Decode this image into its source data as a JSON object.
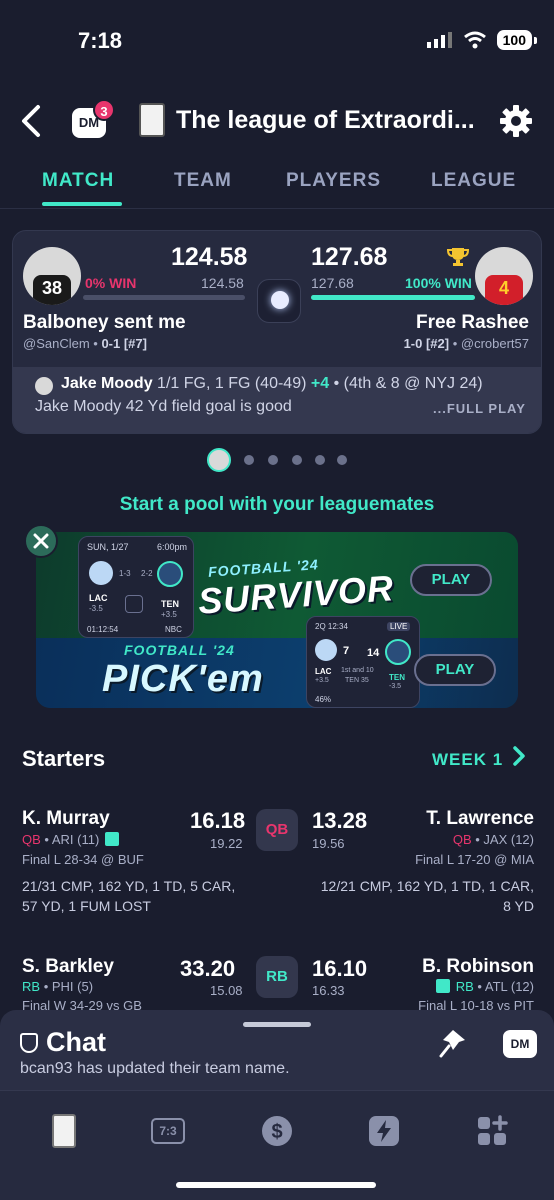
{
  "status_bar": {
    "time": "7:18",
    "battery": "100"
  },
  "header": {
    "dm_label": "DM",
    "dm_badge": "3",
    "league_title": "The league of Extraordi..."
  },
  "tabs": [
    {
      "label": "MATCH",
      "active": true
    },
    {
      "label": "TEAM"
    },
    {
      "label": "PLAYERS"
    },
    {
      "label": "LEAGUE"
    }
  ],
  "match": {
    "left": {
      "jersey": "38",
      "pct_label": "0% WIN",
      "pct_value": 0,
      "score": "124.58",
      "projected": "124.58",
      "team": "Balboney sent me",
      "handle": "@SanClem",
      "record": "0-1 [#7]"
    },
    "right": {
      "jersey": "4",
      "pct_label": "100% WIN",
      "pct_value": 100,
      "score": "127.68",
      "projected": "127.68",
      "team": "Free Rashee",
      "record": "1-0 [#2]",
      "handle": "@crobert57"
    },
    "play": {
      "player": "Jake Moody",
      "line": "1/1 FG, 1 FG (40-49)",
      "points": "+4",
      "context": "• (4th & 8 @ NYJ 24)",
      "description": "Jake Moody 42 Yd field goal is good",
      "full_play": "...FULL PLAY"
    }
  },
  "promo": {
    "title": "Start a pool with your leaguemates",
    "survivor_small": "FOOTBALL '24",
    "survivor_big": "SURVIVOR",
    "survivor_play": "PLAY",
    "pickem_small": "FOOTBALL '24",
    "pickem_big": "PICK'em",
    "pickem_play": "PLAY",
    "card1": {
      "date": "SUN, 1/27",
      "time": "6:00pm",
      "away": "LAC",
      "away_line": "-3.5",
      "home": "TEN",
      "home_line": "+3.5",
      "rec1": "1-3",
      "rec2": "2-2",
      "clock": "01:12:54",
      "network": "NBC"
    },
    "card2": {
      "quarter": "2Q 12:34",
      "live": "LIVE",
      "away": "LAC",
      "away_score": "7",
      "home": "TEN",
      "home_score": "14",
      "down": "1st and 10",
      "spot": "TEN 35",
      "pct": "46%",
      "away_line": "+3.5",
      "home_line": "-3.5"
    }
  },
  "starters": {
    "title": "Starters",
    "week": "WEEK 1",
    "rows": [
      {
        "left": {
          "name": "K. Murray",
          "pos": "QB",
          "team": "• ARI (11)",
          "status": "Final L 28-34 @ BUF",
          "stats1": "21/31 CMP, 162 YD, 1 TD, 5 CAR,",
          "stats2": "57 YD, 1 FUM LOST",
          "score": "16.18",
          "proj": "19.22"
        },
        "slot": "QB",
        "right": {
          "name": "T. Lawrence",
          "pos": "QB",
          "team": "• JAX (12)",
          "status": "Final L 17-20 @ MIA",
          "stats1": "12/21 CMP, 162 YD, 1 TD, 1 CAR,",
          "stats2": "8 YD",
          "score": "13.28",
          "proj": "19.56"
        }
      },
      {
        "left": {
          "name": "S. Barkley",
          "pos": "RB",
          "team": "• PHI (5)",
          "status": "Final W 34-29 vs GB",
          "score": "33.20",
          "proj": "15.08"
        },
        "slot": "RB",
        "right": {
          "name": "B. Robinson",
          "pos": "RB",
          "team": "• ATL (12)",
          "status": "Final L 10-18 vs PIT",
          "score": "16.10",
          "proj": "16.33"
        }
      }
    ]
  },
  "chat": {
    "title": "Chat",
    "message": "bcan93 has updated their team name.",
    "dm_label": "DM"
  },
  "nav": {
    "score_icon_text": "7:3"
  },
  "colors": {
    "accent": "#41e8c8",
    "background": "#1a1d2e",
    "card": "#262a3f",
    "qb_pink": "#e8356d"
  }
}
